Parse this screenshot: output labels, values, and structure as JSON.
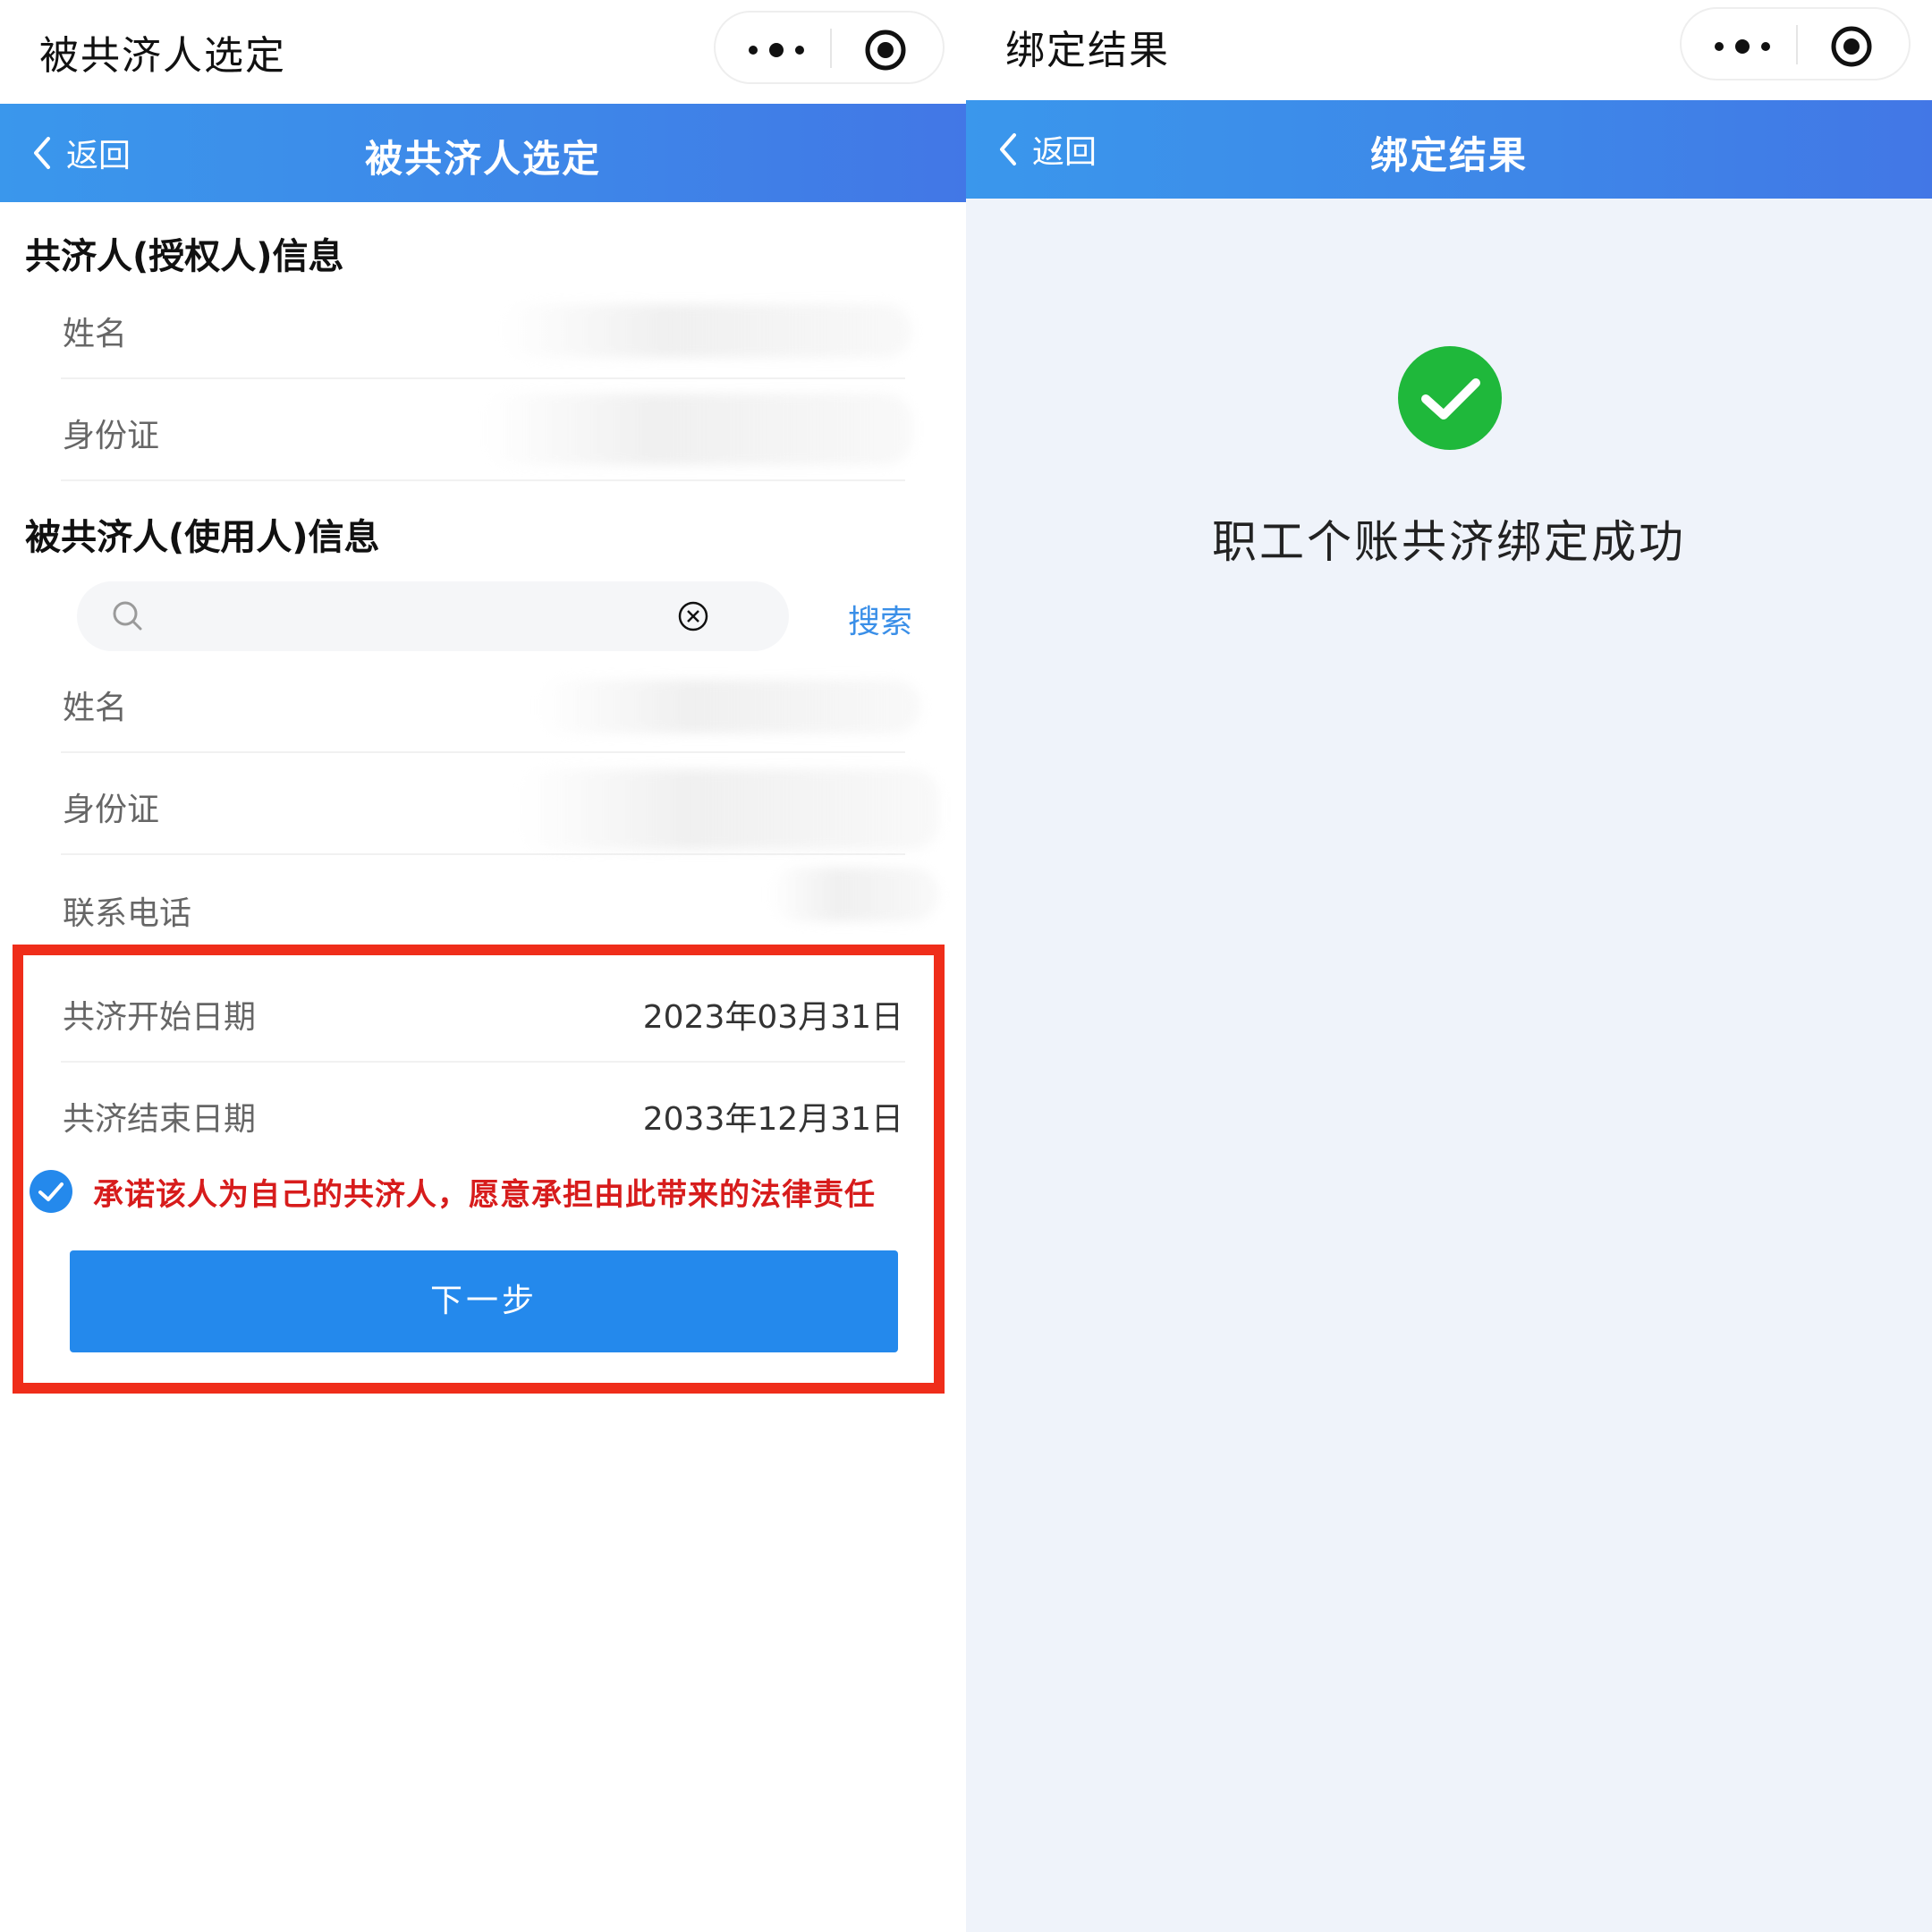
{
  "left": {
    "window_title": "被共济人选定",
    "header": {
      "back_label": "返回",
      "title": "被共济人选定"
    },
    "authorizer_section": {
      "title": "共济人(授权人)信息",
      "fields": [
        {
          "label": "姓名"
        },
        {
          "label": "身份证"
        }
      ]
    },
    "user_section": {
      "title": "被共济人(使用人)信息",
      "search": {
        "placeholder": "",
        "button_label": "搜索"
      },
      "fields": [
        {
          "label": "姓名"
        },
        {
          "label": "身份证"
        },
        {
          "label": "联系电话"
        }
      ]
    },
    "dates": [
      {
        "label": "共济开始日期",
        "value": "2023年03月31日"
      },
      {
        "label": "共济结束日期",
        "value": "2033年12月31日"
      }
    ],
    "promise": {
      "checked": true,
      "text": "承诺该人为自己的共济人，愿意承担由此带来的法律责任"
    },
    "next_button_label": "下一步"
  },
  "right": {
    "window_title": "绑定结果",
    "header": {
      "back_label": "返回",
      "title": "绑定结果"
    },
    "result_text": "职工个账共济绑定成功"
  },
  "colors": {
    "header_gradient_start": "#3a97ec",
    "header_gradient_end": "#4277e6",
    "primary_button": "#2489ec",
    "highlight_frame": "#ef2d1a",
    "promise_text": "#d71c1c",
    "success_green": "#1fb83b",
    "search_link": "#3a8fe8"
  },
  "icons": {
    "capsule_menu": "more-dots-icon",
    "capsule_close": "target-circle-icon",
    "back": "chevron-left-icon",
    "search": "search-icon",
    "clear": "clear-circle-x-icon",
    "checkbox": "checked-circle-icon",
    "result": "success-check-icon"
  }
}
